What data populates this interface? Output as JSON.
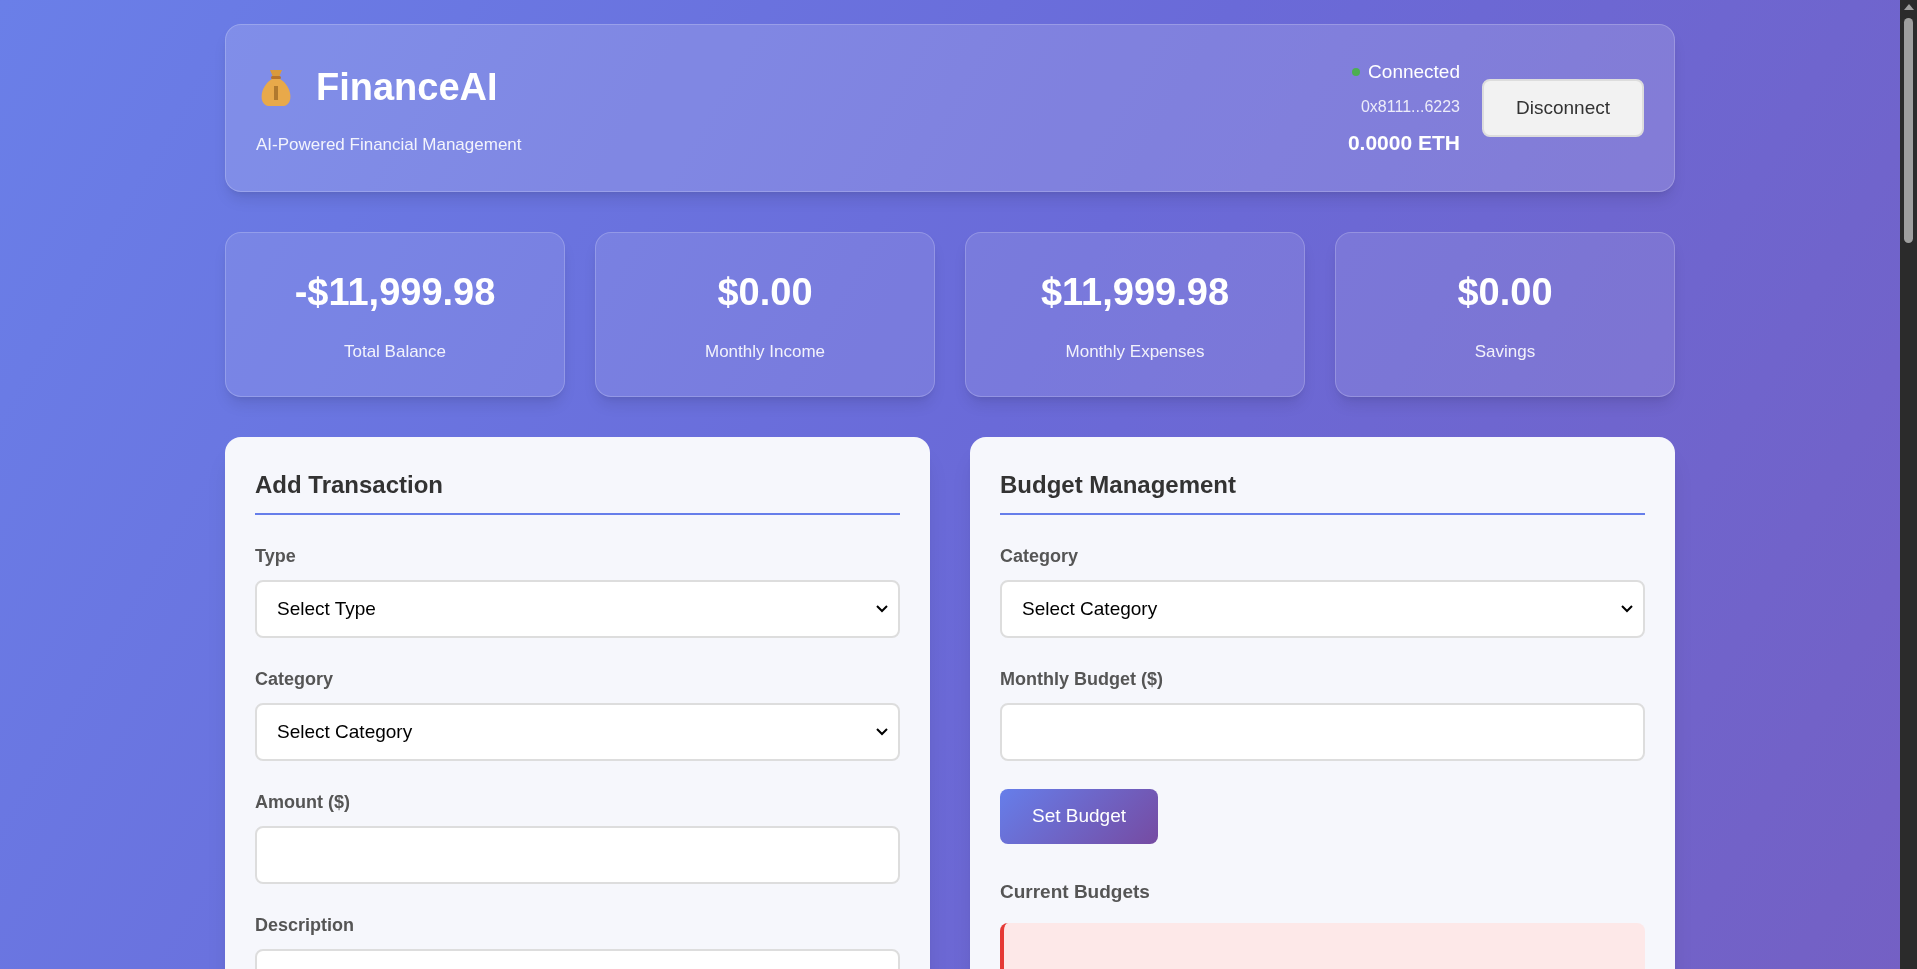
{
  "header": {
    "title": "FinanceAI",
    "subtitle": "AI-Powered Financial Management",
    "connection": {
      "status": "Connected",
      "connected": true
    },
    "address": "0x8111...6223",
    "balance": "0.0000 ETH",
    "button": "Disconnect"
  },
  "stats": [
    {
      "value": "-$11,999.98",
      "label": "Total Balance"
    },
    {
      "value": "$0.00",
      "label": "Monthly Income"
    },
    {
      "value": "$11,999.98",
      "label": "Monthly Expenses"
    },
    {
      "value": "$0.00",
      "label": "Savings"
    }
  ],
  "add_transaction": {
    "title": "Add Transaction",
    "fields": [
      {
        "label": "Type",
        "kind": "select",
        "value": "Select Type"
      },
      {
        "label": "Category",
        "kind": "select",
        "value": "Select Category"
      },
      {
        "label": "Amount ($)",
        "kind": "input"
      },
      {
        "label": "Description",
        "kind": "input"
      }
    ]
  },
  "budget_management": {
    "title": "Budget Management",
    "fields": [
      {
        "label": "Category",
        "kind": "select",
        "value": "Select Category"
      },
      {
        "label": "Monthly Budget ($)",
        "kind": "input"
      }
    ],
    "button": "Set Budget",
    "subtitle": "Current Budgets"
  }
}
